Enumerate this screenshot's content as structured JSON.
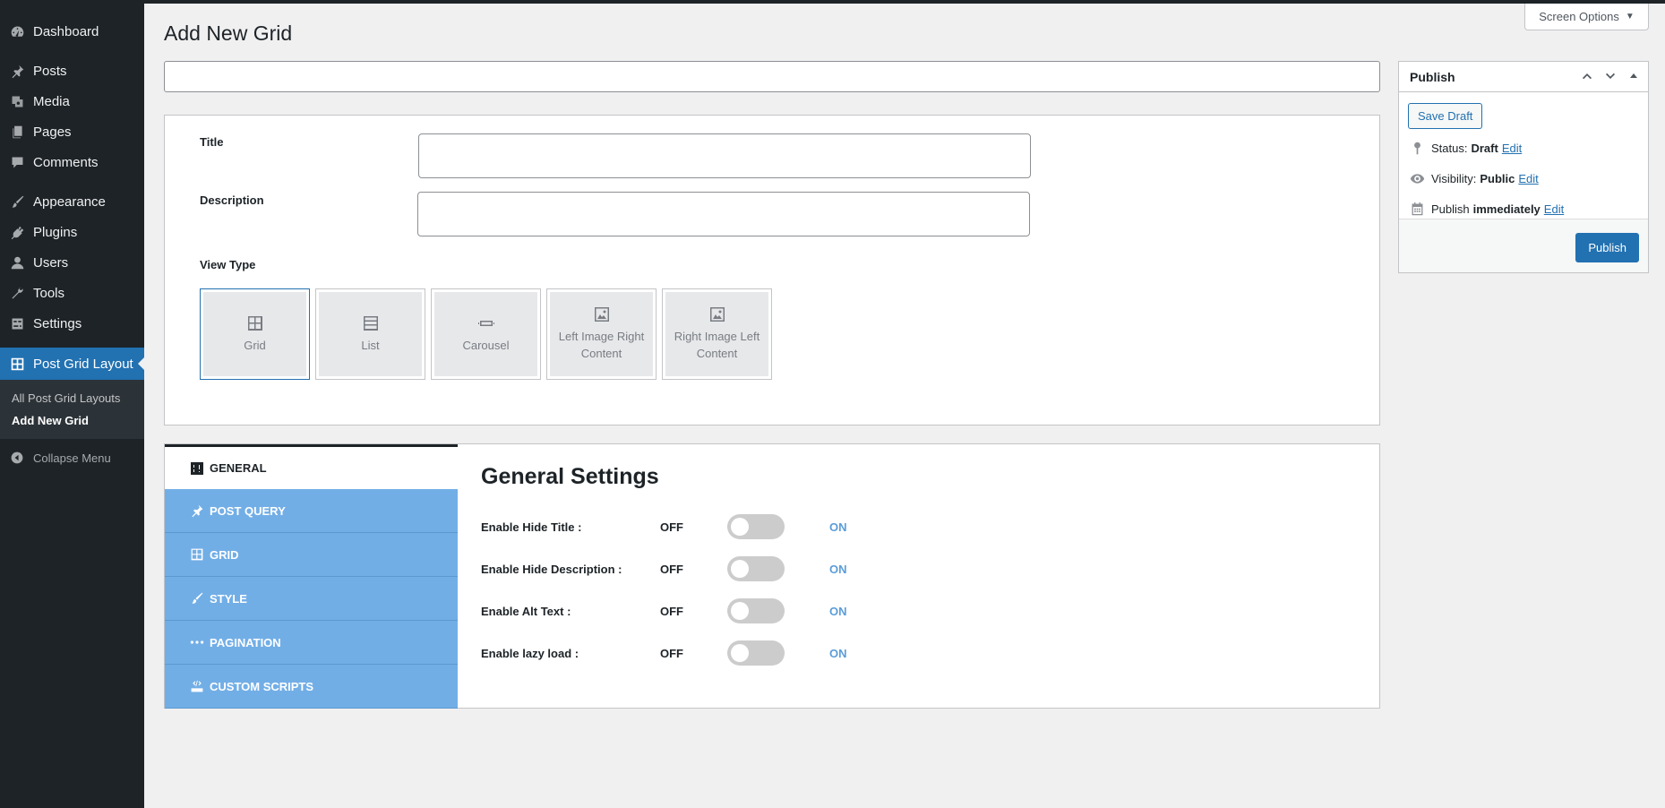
{
  "sidebar": {
    "items": [
      {
        "label": "Dashboard",
        "icon": "dashboard-icon"
      },
      {
        "label": "Posts",
        "icon": "pin-icon"
      },
      {
        "label": "Media",
        "icon": "media-icon"
      },
      {
        "label": "Pages",
        "icon": "pages-icon"
      },
      {
        "label": "Comments",
        "icon": "comment-icon"
      },
      {
        "label": "Appearance",
        "icon": "brush-icon"
      },
      {
        "label": "Plugins",
        "icon": "plugin-icon"
      },
      {
        "label": "Users",
        "icon": "user-icon"
      },
      {
        "label": "Tools",
        "icon": "wrench-icon"
      },
      {
        "label": "Settings",
        "icon": "settings-icon"
      },
      {
        "label": "Post Grid Layout",
        "icon": "grid-icon"
      }
    ],
    "submenu": [
      "All Post Grid Layouts",
      "Add New Grid"
    ],
    "collapse": "Collapse Menu"
  },
  "header": {
    "title": "Add New Grid",
    "screen_options": "Screen Options"
  },
  "form": {
    "title_label": "Title",
    "description_label": "Description",
    "view_type_label": "View Type",
    "view_types": [
      "Grid",
      "List",
      "Carousel",
      "Left Image Right Content",
      "Right Image Left Content"
    ],
    "selected_view_type": "Grid"
  },
  "settings": {
    "tabs": [
      "GENERAL",
      "POST QUERY",
      "GRID",
      "STYLE",
      "PAGINATION",
      "CUSTOM SCRIPTS"
    ],
    "active_tab": "GENERAL",
    "title": "General Settings",
    "off_label": "OFF",
    "on_label": "ON",
    "rows": [
      {
        "label": "Enable Hide Title :",
        "enabled": false
      },
      {
        "label": "Enable Hide Description :",
        "enabled": false
      },
      {
        "label": "Enable Alt Text :",
        "enabled": false
      },
      {
        "label": "Enable lazy load :",
        "enabled": false
      }
    ]
  },
  "publish": {
    "heading": "Publish",
    "save_draft": "Save Draft",
    "status_label": "Status:",
    "status_value": "Draft",
    "visibility_label": "Visibility:",
    "visibility_value": "Public",
    "publish_label": "Publish",
    "publish_value": "immediately",
    "edit": "Edit",
    "publish_button": "Publish"
  },
  "colors": {
    "sidebar_bg": "#1d2327",
    "accent": "#2271b1",
    "tab_bg": "#72aee6",
    "on_text": "#5b9dd9"
  }
}
